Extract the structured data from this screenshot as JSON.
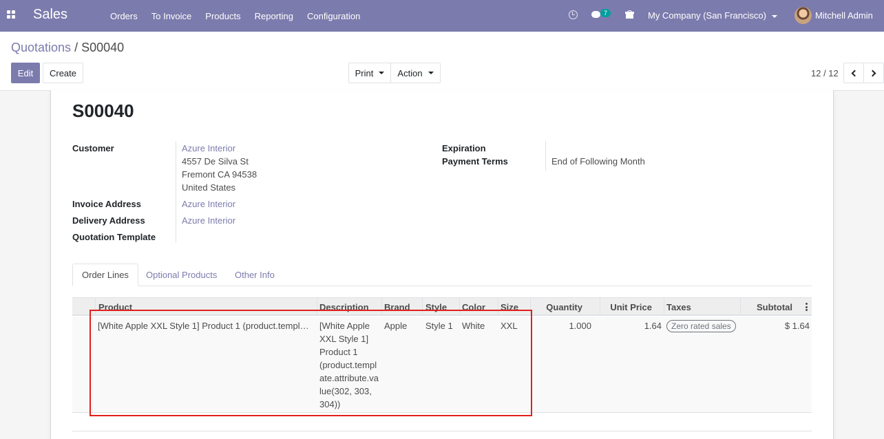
{
  "navbar": {
    "app_name": "Sales",
    "menu": [
      "Orders",
      "To Invoice",
      "Products",
      "Reporting",
      "Configuration"
    ],
    "chat_count": "7",
    "company": "My Company (San Francisco)",
    "user": "Mitchell Admin",
    "accent_color": "#7c7bad"
  },
  "breadcrumb": {
    "parent": "Quotations",
    "separator": " / ",
    "current": "S00040"
  },
  "toolbar": {
    "edit": "Edit",
    "create": "Create",
    "print": "Print",
    "action": "Action"
  },
  "pager": {
    "value": "12 / 12"
  },
  "record": {
    "name": "S00040",
    "fields": {
      "customer_label": "Customer",
      "customer_name": "Azure Interior",
      "customer_street": "4557 De Silva St",
      "customer_city": "Fremont CA 94538",
      "customer_country": "United States",
      "invoice_address_label": "Invoice Address",
      "invoice_address": "Azure Interior",
      "delivery_address_label": "Delivery Address",
      "delivery_address": "Azure Interior",
      "quotation_template_label": "Quotation Template",
      "expiration_label": "Expiration",
      "payment_terms_label": "Payment Terms",
      "payment_terms": "End of Following Month"
    }
  },
  "tabs": [
    "Order Lines",
    "Optional Products",
    "Other Info"
  ],
  "table": {
    "headers": [
      "Product",
      "Description",
      "Brand",
      "Style",
      "Color",
      "Size",
      "Quantity",
      "Unit Price",
      "Taxes",
      "Subtotal"
    ],
    "rows": [
      {
        "product": "[White Apple XXL Style 1] Product 1 (product.templ…",
        "description_lines": [
          "[White Apple",
          "XXL Style 1]",
          "Product 1",
          "(product.templ",
          "ate.attribute.va",
          "lue(302, 303,",
          "304))"
        ],
        "brand": "Apple",
        "style": "Style 1",
        "color": "White",
        "size": "XXL",
        "quantity": "1.000",
        "unit_price": "1.64",
        "taxes": "Zero rated sales",
        "subtotal": "$ 1.64"
      }
    ]
  }
}
